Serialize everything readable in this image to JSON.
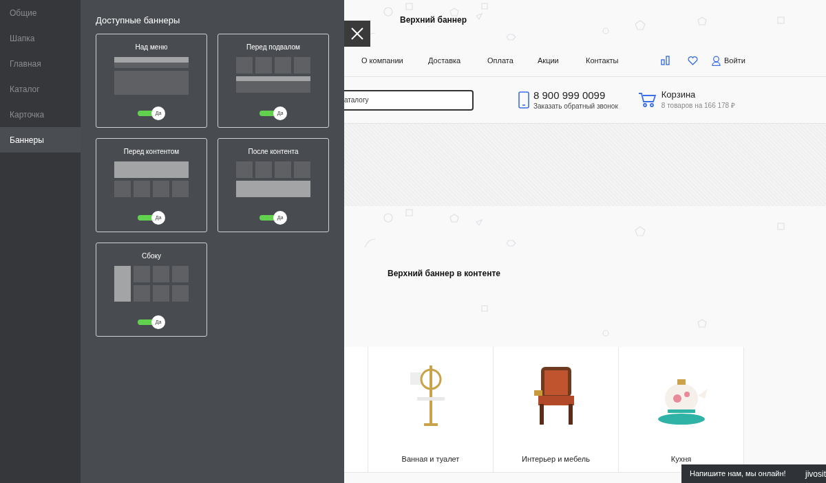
{
  "sidebar": {
    "items": [
      {
        "label": "Общие",
        "selected": false
      },
      {
        "label": "Шапка",
        "selected": false
      },
      {
        "label": "Главная",
        "selected": false
      },
      {
        "label": "Каталог",
        "selected": false
      },
      {
        "label": "Карточка",
        "selected": false
      },
      {
        "label": "Баннеры",
        "selected": true
      }
    ]
  },
  "panel": {
    "title": "Доступные баннеры",
    "banners": [
      {
        "title": "Над меню",
        "kind": "over_menu",
        "on": true,
        "toggle_label": "Да"
      },
      {
        "title": "Перед подвалом",
        "kind": "before_footer",
        "on": true,
        "toggle_label": "Да"
      },
      {
        "title": "Перед контентом",
        "kind": "before_content",
        "on": true,
        "toggle_label": "Да"
      },
      {
        "title": "После контента",
        "kind": "after_content",
        "on": true,
        "toggle_label": "Да"
      },
      {
        "title": "Сбоку",
        "kind": "side",
        "on": true,
        "toggle_label": "Да"
      }
    ]
  },
  "site": {
    "top_banner_title": "Верхний баннер",
    "nav": [
      "О компании",
      "Доставка",
      "Оплата",
      "Акции",
      "Контакты"
    ],
    "login": "Войти",
    "search": {
      "placeholder": "аталогу"
    },
    "phone": {
      "number": "8 900 999 0099",
      "callback": "Заказать обратный звонок"
    },
    "cart": {
      "title": "Корзина",
      "summary": "8 товаров на 166 178 ₽"
    },
    "content_banner_title": "Верхний баннер в контенте",
    "categories": [
      {
        "label": "Ванная и туалет",
        "kind": "bath"
      },
      {
        "label": "Интерьер и мебель",
        "kind": "chair"
      },
      {
        "label": "Кухня",
        "kind": "teapot"
      }
    ]
  },
  "chat": {
    "message": "Напишите нам, мы онлайн!",
    "brand": "jivosit"
  }
}
